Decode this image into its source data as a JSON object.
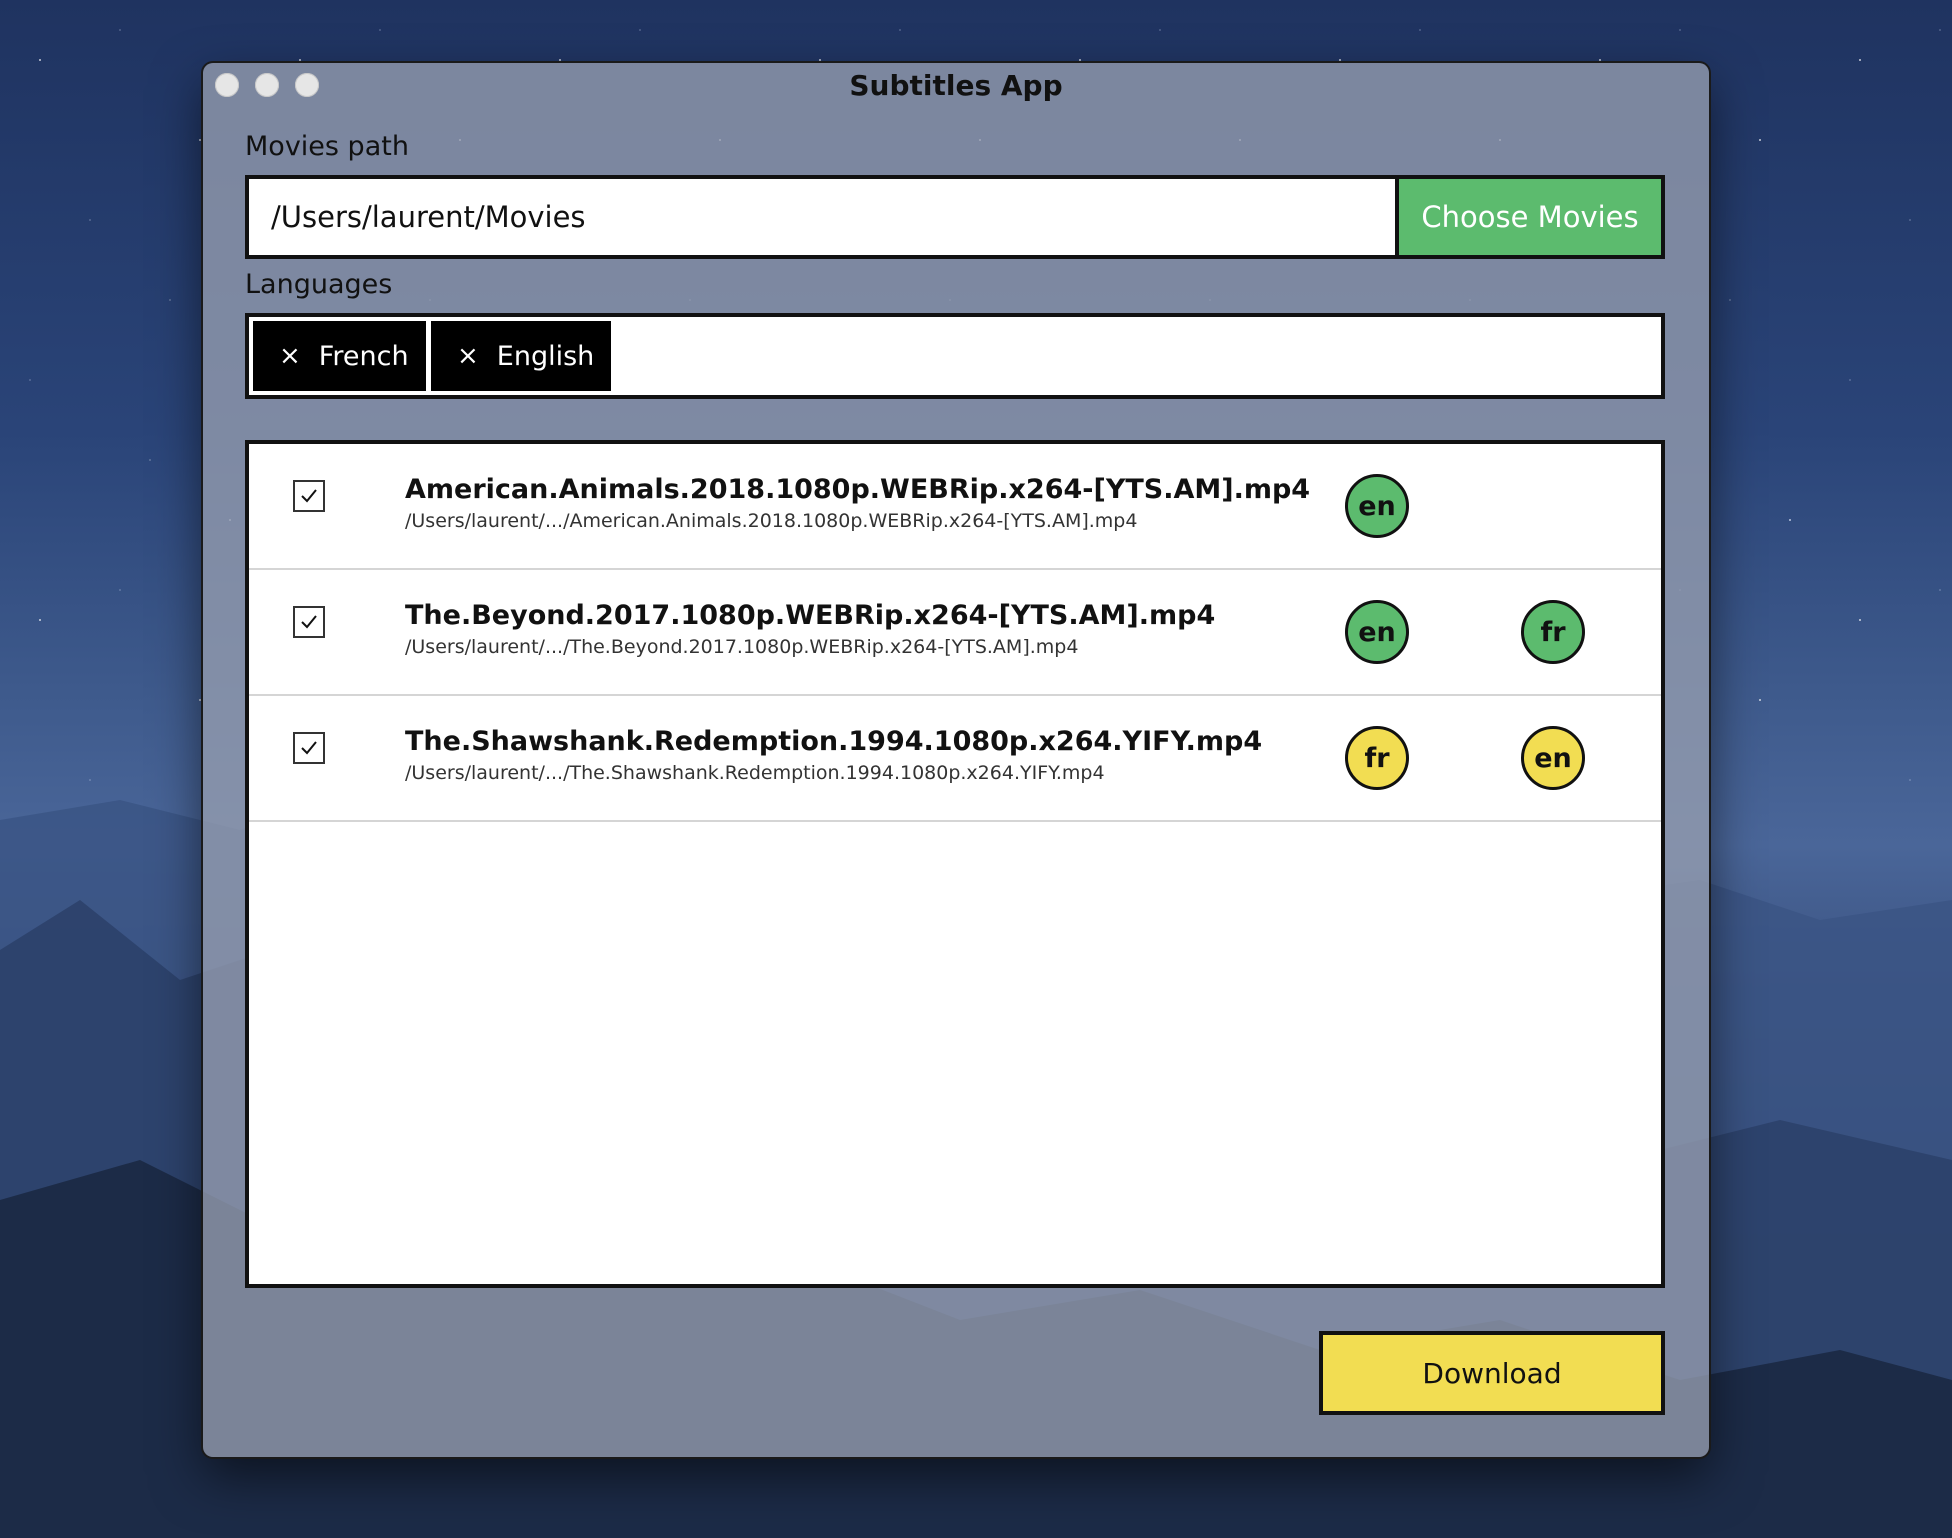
{
  "window": {
    "title": "Subtitles App"
  },
  "movies_path": {
    "label": "Movies path",
    "value": "/Users/laurent/Movies",
    "button_label": "Choose Movies"
  },
  "languages": {
    "label": "Languages",
    "tags": [
      {
        "remove_icon": "×",
        "label": "French"
      },
      {
        "remove_icon": "×",
        "label": "English"
      }
    ]
  },
  "movies": [
    {
      "checked": true,
      "name": "American.Animals.2018.1080p.WEBRip.x264-[YTS.AM].mp4",
      "path": "/Users/laurent/.../American.Animals.2018.1080p.WEBRip.x264-[YTS.AM].mp4",
      "subtitles": [
        {
          "code": "en",
          "status": "green"
        }
      ]
    },
    {
      "checked": true,
      "name": "The.Beyond.2017.1080p.WEBRip.x264-[YTS.AM].mp4",
      "path": "/Users/laurent/.../The.Beyond.2017.1080p.WEBRip.x264-[YTS.AM].mp4",
      "subtitles": [
        {
          "code": "en",
          "status": "green"
        },
        {
          "code": "fr",
          "status": "green"
        }
      ]
    },
    {
      "checked": true,
      "name": "The.Shawshank.Redemption.1994.1080p.x264.YIFY.mp4",
      "path": "/Users/laurent/.../The.Shawshank.Redemption.1994.1080p.x264.YIFY.mp4",
      "subtitles": [
        {
          "code": "fr",
          "status": "yellow"
        },
        {
          "code": "en",
          "status": "yellow"
        }
      ]
    }
  ],
  "actions": {
    "download_label": "Download"
  },
  "colors": {
    "green": "#5cbb6e",
    "yellow": "#f2dd52",
    "tag_bg": "#000000"
  }
}
